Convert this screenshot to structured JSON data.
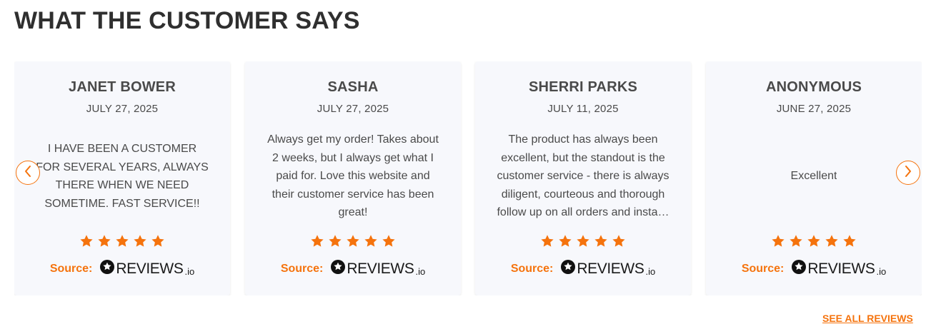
{
  "section": {
    "title": "WHAT THE CUSTOMER SAYS",
    "see_all_label": "SEE ALL REVIEWS"
  },
  "colors": {
    "accent": "#f5730d",
    "card_bg": "#f7f8fc",
    "text": "#4a4a4a",
    "title": "#2f2f2f"
  },
  "icons": {
    "prev": "chevron-left-icon",
    "next": "chevron-right-icon",
    "star": "star-icon",
    "logo": "reviews-io-logo"
  },
  "reviews": [
    {
      "name": "JANET BOWER",
      "date": "JULY 27, 2025",
      "text": "I HAVE BEEN A CUSTOMER FOR SEVERAL YEARS, ALWAYS THERE WHEN WE NEED SOMETIME. FAST SERVICE!!",
      "rating": 5,
      "source_label": "Source:",
      "source_name": "REVIEWS",
      "source_suffix": ".io"
    },
    {
      "name": "SASHA",
      "date": "JULY 27, 2025",
      "text": "Always get my order! Takes about 2 weeks, but I always get what I paid for. Love this website and their customer service has been great!",
      "rating": 5,
      "source_label": "Source:",
      "source_name": "REVIEWS",
      "source_suffix": ".io"
    },
    {
      "name": "SHERRI PARKS",
      "date": "JULY 11, 2025",
      "text": "The product has always been excellent, but the standout is the customer service - there is always diligent, courteous and thorough follow up on all orders and insta…",
      "rating": 5,
      "source_label": "Source:",
      "source_name": "REVIEWS",
      "source_suffix": ".io"
    },
    {
      "name": "ANONYMOUS",
      "date": "JUNE 27, 2025",
      "text": "Excellent",
      "rating": 5,
      "source_label": "Source:",
      "source_name": "REVIEWS",
      "source_suffix": ".io"
    }
  ]
}
